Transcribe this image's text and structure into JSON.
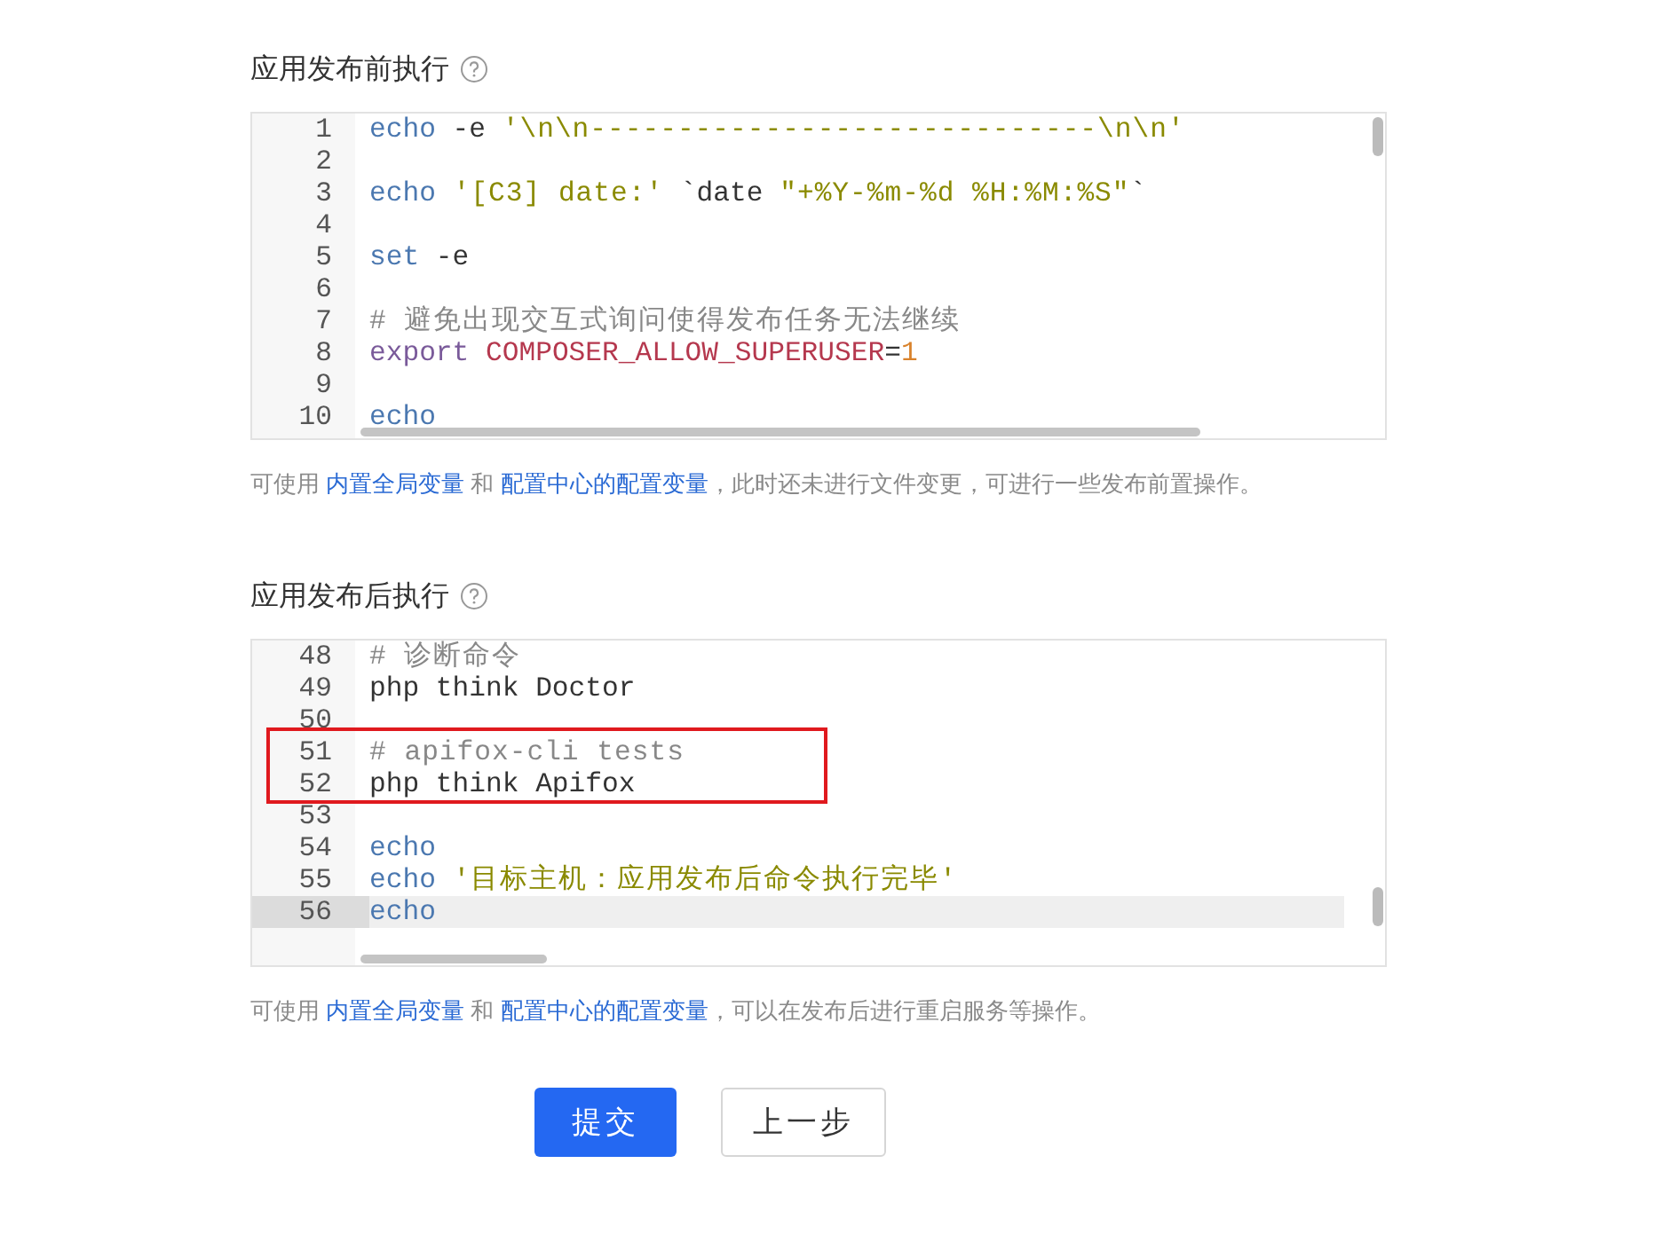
{
  "sections": [
    {
      "title": "应用发布前执行",
      "lines": [
        {
          "number": "1",
          "active": false,
          "tokens": [
            {
              "kind": "keyword",
              "text": "echo"
            },
            {
              "kind": "plain",
              "text": " -e "
            },
            {
              "kind": "string",
              "text": "'\\n\\n-----------------------------\\n\\n'"
            }
          ]
        },
        {
          "number": "2",
          "active": false
        },
        {
          "number": "3",
          "active": false,
          "tokens": [
            {
              "kind": "keyword",
              "text": "echo"
            },
            {
              "kind": "string",
              "text": " '[C3] date:'"
            },
            {
              "kind": "plain",
              "text": " `date "
            },
            {
              "kind": "string",
              "text": "\"+%Y-%m-%d %H:%M:%S\""
            },
            {
              "kind": "plain",
              "text": "`"
            }
          ]
        },
        {
          "number": "4",
          "active": false
        },
        {
          "number": "5",
          "active": false,
          "tokens": [
            {
              "kind": "keyword",
              "text": "set"
            },
            {
              "kind": "plain",
              "text": " -e"
            }
          ]
        },
        {
          "number": "6",
          "active": false
        },
        {
          "number": "7",
          "active": false,
          "tokens": [
            {
              "kind": "comment",
              "text": "# 避免出现交互式询问使得发布任务无法继续"
            }
          ]
        },
        {
          "number": "8",
          "active": false,
          "tokens": [
            {
              "kind": "keyword-alt",
              "text": "export"
            },
            {
              "kind": "variable",
              "text": " COMPOSER_ALLOW_SUPERUSER"
            },
            {
              "kind": "plain",
              "text": "="
            },
            {
              "kind": "number",
              "text": "1"
            }
          ]
        },
        {
          "number": "9",
          "active": false
        },
        {
          "number": "10",
          "active": false,
          "tokens": [
            {
              "kind": "keyword",
              "text": "echo"
            }
          ]
        }
      ],
      "hint": [
        "可使用 ",
        {
          "link": "内置全局变量"
        },
        " 和 ",
        {
          "link": "配置中心的配置变量"
        },
        "，此时还未进行文件变更，可进行一些发布前置操作。"
      ]
    },
    {
      "title": "应用发布后执行",
      "lines": [
        {
          "number": "48",
          "active": false,
          "boxed": false,
          "tokens": [
            {
              "kind": "comment",
              "text": "# 诊断命令"
            }
          ]
        },
        {
          "number": "49",
          "active": false,
          "boxed": false,
          "tokens": [
            {
              "kind": "plain",
              "text": "php think Doctor"
            }
          ]
        },
        {
          "number": "50",
          "active": false,
          "boxed": false
        },
        {
          "number": "51",
          "active": false,
          "boxed": true,
          "tokens": [
            {
              "kind": "comment",
              "text": "# apifox-cli tests"
            }
          ]
        },
        {
          "number": "52",
          "active": false,
          "boxed": true,
          "tokens": [
            {
              "kind": "plain",
              "text": "php think Apifox"
            }
          ]
        },
        {
          "number": "53",
          "active": false,
          "boxed": false
        },
        {
          "number": "54",
          "active": false,
          "boxed": false,
          "tokens": [
            {
              "kind": "keyword",
              "text": "echo"
            }
          ]
        },
        {
          "number": "55",
          "active": false,
          "boxed": false,
          "tokens": [
            {
              "kind": "keyword",
              "text": "echo"
            },
            {
              "kind": "string",
              "text": " '目标主机：应用发布后命令执行完毕'"
            }
          ]
        },
        {
          "number": "56",
          "active": true,
          "boxed": false,
          "tokens": [
            {
              "kind": "keyword",
              "text": "echo"
            }
          ]
        }
      ],
      "hint": [
        "可使用 ",
        {
          "link": "内置全局变量"
        },
        " 和 ",
        {
          "link": "配置中心的配置变量"
        },
        "，可以在发布后进行重启服务等操作。"
      ]
    }
  ],
  "buttons": [
    {
      "label": "提交",
      "kind": "primary"
    },
    {
      "label": "上一步",
      "kind": "default"
    }
  ]
}
